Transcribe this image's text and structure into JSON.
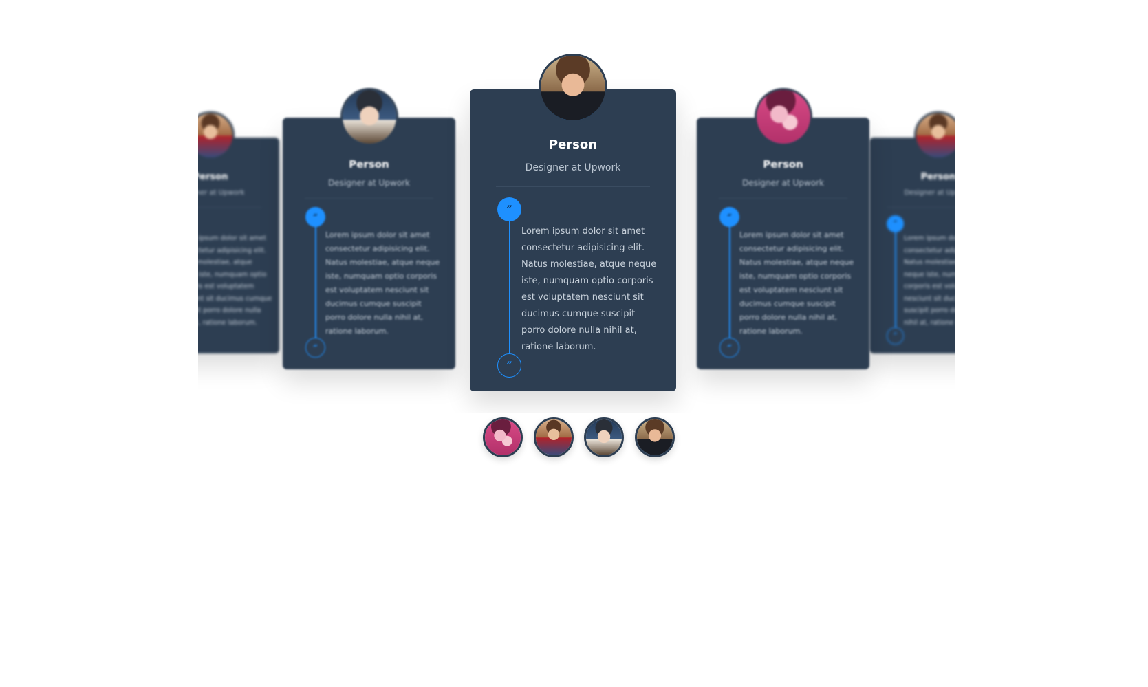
{
  "colors": {
    "card_background": "#2d3e52",
    "accent": "#1e90ff",
    "page_background": "#ffffff",
    "name_text": "#ffffff",
    "role_text": "#b9c4d0",
    "body_text": "#c8d1db"
  },
  "quote_glyph": "”",
  "cards": [
    {
      "position": "left-far",
      "avatar_icon": "boy-crowd-avatar",
      "name": "Person",
      "role": "Designer at Upwork",
      "text": "Lorem ipsum dolor sit amet consectetur adipisicing elit. Natus molestiae, atque neque iste, numquam optio corporis est voluptatem nesciunt sit ducimus cumque suscipit porro dolore nulla nihil at, ratione laborum."
    },
    {
      "position": "left-mid",
      "avatar_icon": "man-glasses-avatar",
      "name": "Person",
      "role": "Designer at Upwork",
      "text": "Lorem ipsum dolor sit amet consectetur adipisicing elit. Natus molestiae, atque neque iste, numquam optio corporis est voluptatem nesciunt sit ducimus cumque suscipit porro dolore nulla nihil at, ratione laborum."
    },
    {
      "position": "center",
      "avatar_icon": "woman-glasses-avatar",
      "name": "Person",
      "role": "Designer at Upwork",
      "text": "Lorem ipsum dolor sit amet consectetur adipisicing elit. Natus molestiae, atque neque iste, numquam optio corporis est voluptatem nesciunt sit ducimus cumque suscipit porro dolore nulla nihil at, ratione laborum."
    },
    {
      "position": "right-mid",
      "avatar_icon": "pink-avatar",
      "name": "Person",
      "role": "Designer at Upwork",
      "text": "Lorem ipsum dolor sit amet consectetur adipisicing elit. Natus molestiae, atque neque iste, numquam optio corporis est voluptatem nesciunt sit ducimus cumque suscipit porro dolore nulla nihil at, ratione laborum."
    },
    {
      "position": "right-far",
      "avatar_icon": "boy-crowd-avatar",
      "name": "Person",
      "role": "Designer at Upwork",
      "text": "Lorem ipsum dolor sit amet consectetur adipisicing elit. Natus molestiae, atque neque iste, numquam optio corporis est voluptatem nesciunt sit ducimus cumque suscipit porro dolore nulla nihil at, ratione laborum."
    }
  ],
  "thumbnails": [
    {
      "avatar_icon": "pink-avatar",
      "active": false
    },
    {
      "avatar_icon": "boy-crowd-avatar",
      "active": false
    },
    {
      "avatar_icon": "man-glasses-avatar",
      "active": false
    },
    {
      "avatar_icon": "woman-glasses-avatar",
      "active": true
    }
  ]
}
